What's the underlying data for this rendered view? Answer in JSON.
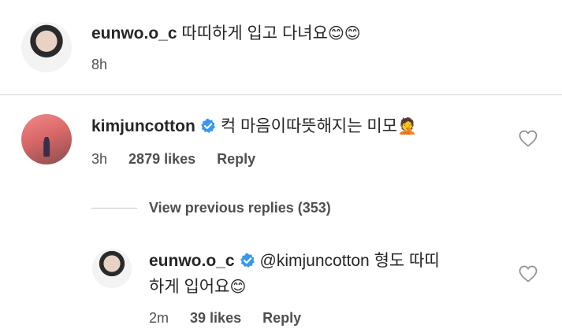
{
  "comments": [
    {
      "username": "eunwo.o_c",
      "text": "따띠하게 입고 다녀요",
      "emoji": "😊😊",
      "time": "8h"
    },
    {
      "username": "kimjuncotton",
      "verified": true,
      "text": "컥 마음이따뜻해지는 미모",
      "emoji": "🤦",
      "time": "3h",
      "likes": "2879 likes",
      "reply_label": "Reply"
    }
  ],
  "view_previous_replies": "View previous replies (353)",
  "reply": {
    "username": "eunwo.o_c",
    "verified": true,
    "text_line1": "@kimjuncotton 형도 따띠",
    "text_line2": "하게 입어요",
    "emoji": "😊",
    "time": "2m",
    "likes": "39 likes",
    "reply_label": "Reply"
  },
  "colors": {
    "verified_badge": "#3897f0",
    "divider": "#dbdbdb",
    "secondary_text": "#4f4f4f"
  }
}
